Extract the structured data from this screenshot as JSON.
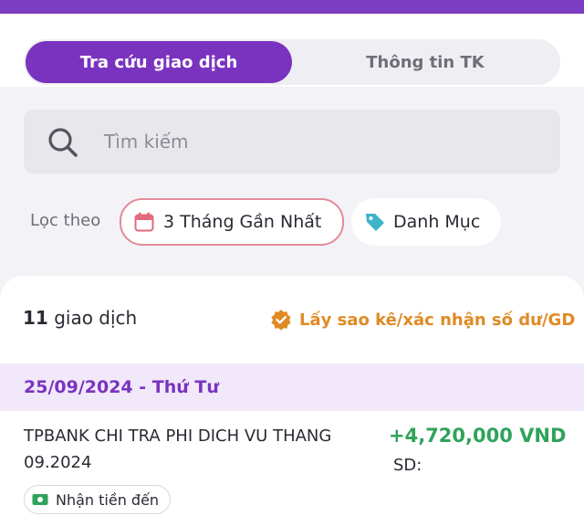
{
  "tabs": [
    {
      "label": "Tra cứu giao dịch",
      "active": true
    },
    {
      "label": "Thông tin TK",
      "active": false
    }
  ],
  "search": {
    "placeholder": "Tìm kiếm",
    "icon": "search-icon"
  },
  "filters": {
    "label": "Lọc theo",
    "date_chip": {
      "label": "3 Tháng Gần Nhất",
      "icon": "calendar-icon"
    },
    "category_chip": {
      "label": "Danh Mục",
      "icon": "tag-icon"
    }
  },
  "summary": {
    "count": "11",
    "count_suffix": "giao dịch",
    "statement_link": "Lấy sao kê/xác nhận số dư/GD",
    "statement_icon": "verified-badge-icon"
  },
  "date_group": {
    "label": "25/09/2024 - Thứ Tư"
  },
  "transaction": {
    "description": "TPBANK CHI TRA PHI DICH VU THANG 09.2024",
    "amount": "+4,720,000 VND",
    "balance_label": "SD:",
    "tag": "Nhận tiền đến",
    "tag_icon": "money-icon"
  },
  "colors": {
    "accent": "#7a33bf",
    "date_chip_border": "#e48a98",
    "positive_amount": "#2fa35a",
    "link_orange": "#e08a26",
    "date_header_bg": "#f1e8f9"
  }
}
